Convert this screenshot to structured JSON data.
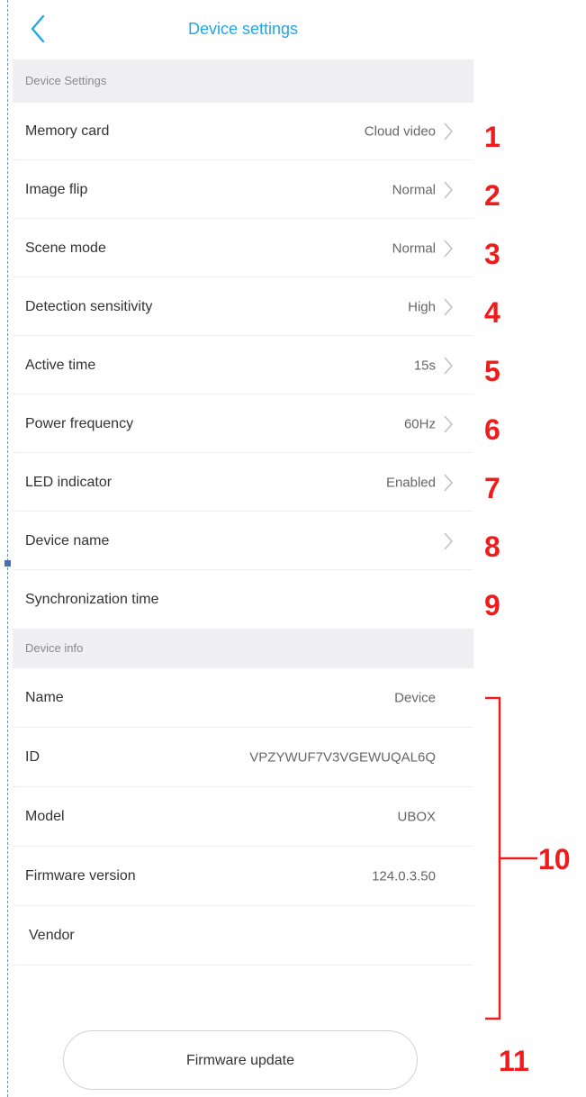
{
  "header": {
    "back_icon": "chevron-left-icon",
    "title": "Device settings"
  },
  "settings_section": {
    "title": "Device Settings",
    "items": [
      {
        "label": "Memory card",
        "value": "Cloud video",
        "icon": "chevron-right-icon"
      },
      {
        "label": "Image flip",
        "value": "Normal",
        "icon": "chevron-right-icon"
      },
      {
        "label": "Scene mode",
        "value": "Normal",
        "icon": "chevron-right-icon"
      },
      {
        "label": "Detection sensitivity",
        "value": "High",
        "icon": "chevron-right-icon"
      },
      {
        "label": "Active time",
        "value": "15s",
        "icon": "chevron-right-icon"
      },
      {
        "label": "Power frequency",
        "value": "60Hz",
        "icon": "chevron-right-icon"
      },
      {
        "label": "LED indicator",
        "value": "Enabled",
        "icon": "chevron-right-icon"
      },
      {
        "label": "Device name",
        "value": "",
        "icon": "chevron-right-icon"
      },
      {
        "label": "Synchronization time"
      }
    ]
  },
  "info_section": {
    "title": "Device info",
    "items": [
      {
        "label": "Name",
        "value": "Device"
      },
      {
        "label": "ID",
        "value": "VPZYWUF7V3VGEWUQAL6Q"
      },
      {
        "label": "Model",
        "value": "UBOX"
      },
      {
        "label": "Firmware version",
        "value": "124.0.3.50"
      },
      {
        "label": "Vendor",
        "value": ""
      }
    ]
  },
  "firmware_button": {
    "label": "Firmware update"
  },
  "annotations": {
    "markers": [
      "1",
      "2",
      "3",
      "4",
      "5",
      "6",
      "7",
      "8",
      "9",
      "10",
      "11"
    ],
    "color": "#ee1c1c"
  },
  "colors": {
    "accent": "#22a8e8",
    "section_background": "#efeff1"
  }
}
